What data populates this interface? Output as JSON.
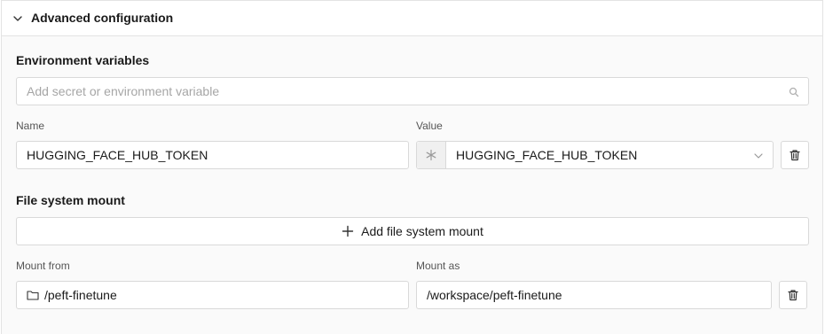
{
  "section": {
    "title": "Advanced configuration"
  },
  "env": {
    "heading": "Environment variables",
    "search_placeholder": "Add secret or environment variable",
    "name_label": "Name",
    "value_label": "Value",
    "name_value": "HUGGING_FACE_HUB_TOKEN",
    "value_value": "HUGGING_FACE_HUB_TOKEN"
  },
  "fs": {
    "heading": "File system mount",
    "add_label": "Add file system mount",
    "from_label": "Mount from",
    "as_label": "Mount as",
    "from_value": "/peft-finetune",
    "as_value": "/workspace/peft-finetune"
  },
  "icons": {
    "collapse": "chevron-down-icon",
    "search": "search-icon",
    "secret": "asterisk-icon",
    "dropdown": "chevron-down-icon",
    "delete": "trash-icon",
    "add": "plus-icon",
    "folder": "folder-icon"
  }
}
